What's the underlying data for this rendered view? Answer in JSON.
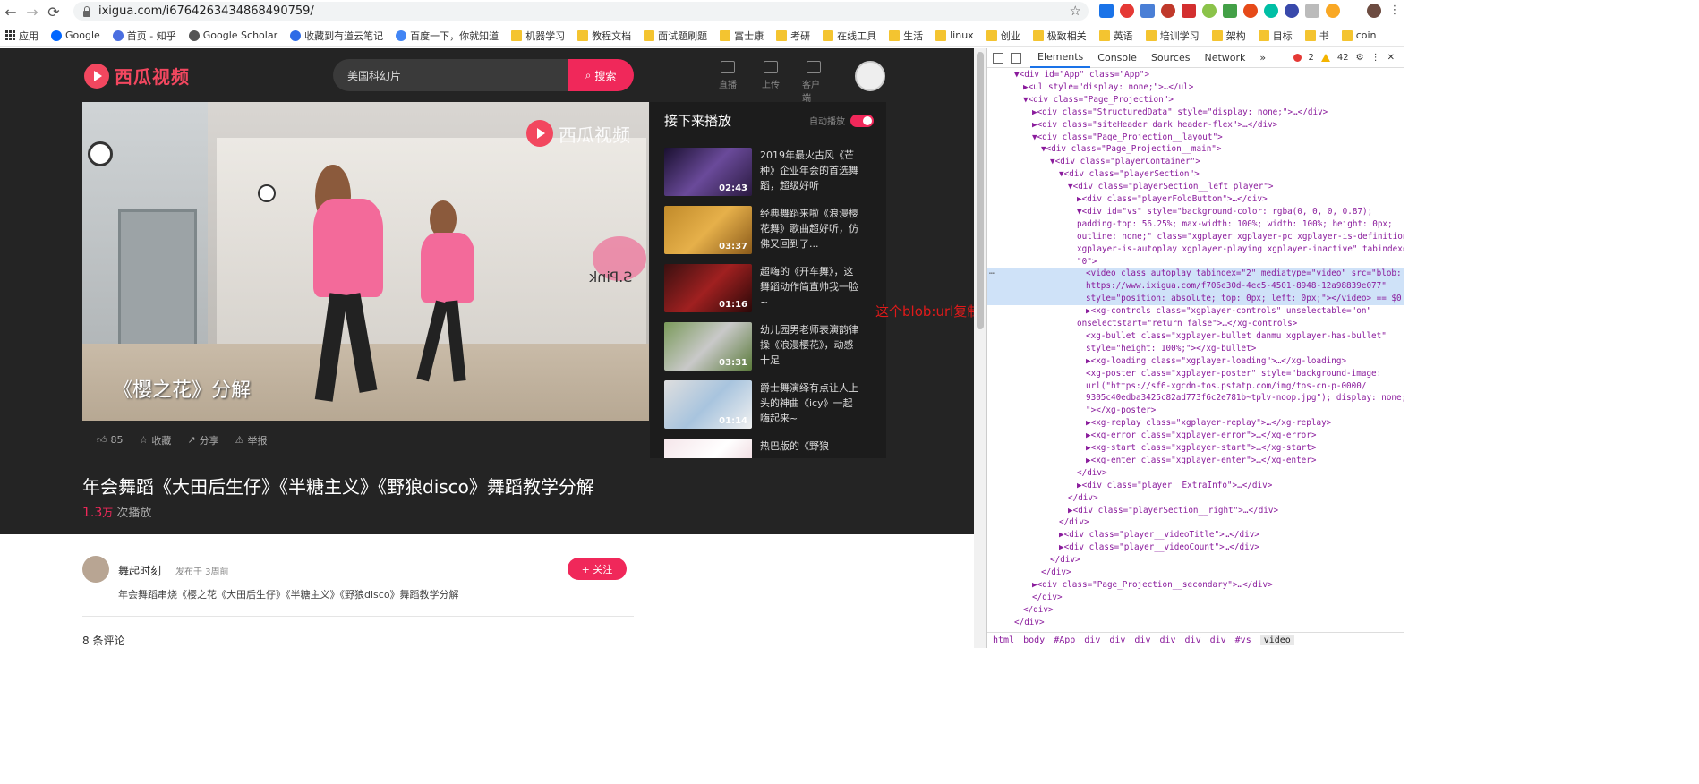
{
  "browser": {
    "url": "ixigua.com/i6764263434868490759/",
    "bookmarks": [
      {
        "label": "应用",
        "icon": "apps-grid-icon"
      },
      {
        "label": "Google",
        "icon": "google-icon"
      },
      {
        "label": "首页 - 知乎",
        "icon": "zhihu-icon"
      },
      {
        "label": "Google Scholar",
        "icon": "scholar-icon"
      },
      {
        "label": "收藏到有道云笔记",
        "icon": "youdao-icon"
      },
      {
        "label": "百度一下，你就知道",
        "icon": "baidu-icon"
      },
      {
        "label": "机器学习",
        "icon": "folder-icon"
      },
      {
        "label": "教程文档",
        "icon": "folder-icon"
      },
      {
        "label": "面试题刷题",
        "icon": "folder-icon"
      },
      {
        "label": "富士康",
        "icon": "folder-icon"
      },
      {
        "label": "考研",
        "icon": "folder-icon"
      },
      {
        "label": "在线工具",
        "icon": "folder-icon"
      },
      {
        "label": "生活",
        "icon": "folder-icon"
      },
      {
        "label": "linux",
        "icon": "folder-icon"
      },
      {
        "label": "创业",
        "icon": "folder-icon"
      },
      {
        "label": "极致相关",
        "icon": "folder-icon"
      },
      {
        "label": "英语",
        "icon": "folder-icon"
      },
      {
        "label": "培训学习",
        "icon": "folder-icon"
      },
      {
        "label": "架构",
        "icon": "folder-icon"
      },
      {
        "label": "目标",
        "icon": "folder-icon"
      },
      {
        "label": "书",
        "icon": "folder-icon"
      },
      {
        "label": "coin",
        "icon": "folder-icon"
      }
    ]
  },
  "site": {
    "logo": "西瓜视频",
    "search_value": "美国科幻片",
    "search_button": "搜索",
    "header_icons": [
      {
        "label": "直播",
        "icon": "live-icon"
      },
      {
        "label": "上传",
        "icon": "upload-icon"
      },
      {
        "label": "客户端",
        "icon": "client-icon"
      }
    ],
    "video": {
      "watermark": "西瓜视频",
      "overlay_title": "《樱之花》分解",
      "brand_text": "S.Pink",
      "likes": "85",
      "collect": "收藏",
      "share": "分享",
      "report": "举报"
    },
    "up_next": {
      "heading": "接下来播放",
      "autoplay": "自动播放",
      "items": [
        {
          "title": "2019年最火古风《芒种》企业年会的首选舞蹈，超级好听",
          "duration": "02:43"
        },
        {
          "title": "经典舞蹈来啦《浪漫樱花舞》歌曲超好听，仿佛又回到了...",
          "duration": "03:37"
        },
        {
          "title": "超嗨的《开车舞》，这舞蹈动作简直帅我一脸~",
          "duration": "01:16"
        },
        {
          "title": "幼儿园男老师表演韵律操《浪漫樱花》，动感十足",
          "duration": "03:31"
        },
        {
          "title": "爵士舞演绎有点让人上头的神曲《icy》一起嗨起来~",
          "duration": "01:14"
        },
        {
          "title": "热巴版的《野狼",
          "duration": ""
        }
      ]
    },
    "title": "年会舞蹈《大田后生仔》《半糖主义》《野狼disco》舞蹈教学分解",
    "plays_num": "1.3",
    "plays_unit": "万",
    "plays_suffix": " 次播放",
    "author": "舞起时刻",
    "published": "发布于 3周前",
    "follow": "+ 关注",
    "description": "年会舞蹈串烧《樱之花《大田后生仔》《半糖主义》《野狼disco》舞蹈教学分解",
    "comments": "8 条评论"
  },
  "annotation": "这个blob:url复制后下载不了",
  "devtools": {
    "tabs": [
      "Elements",
      "Console",
      "Sources",
      "Network",
      "»"
    ],
    "errors": "2",
    "warnings": "42",
    "breadcrumbs": [
      "html",
      "body",
      "#App",
      "div",
      "div",
      "div",
      "div",
      "div",
      "div",
      "#vs",
      "video"
    ],
    "dom_lines": [
      {
        "indent": 3,
        "text": "▼<div id=\"App\" class=\"App\">"
      },
      {
        "indent": 4,
        "text": "▶<ul style=\"display: none;\">…</ul>"
      },
      {
        "indent": 4,
        "text": "▼<div class=\"Page_Projection\">"
      },
      {
        "indent": 5,
        "text": "▶<div class=\"StructuredData\" style=\"display: none;\">…</div>"
      },
      {
        "indent": 5,
        "text": "▶<div class=\"siteHeader dark header-flex\">…</div>"
      },
      {
        "indent": 5,
        "text": "▼<div class=\"Page_Projection__layout\">"
      },
      {
        "indent": 6,
        "text": "▼<div class=\"Page_Projection__main\">"
      },
      {
        "indent": 7,
        "text": "▼<div class=\"playerContainer\">"
      },
      {
        "indent": 8,
        "text": "▼<div class=\"playerSection\">"
      },
      {
        "indent": 9,
        "text": "▼<div class=\"playerSection__left player\">"
      },
      {
        "indent": 10,
        "text": "▶<div class=\"playerFoldButton\">…</div>"
      },
      {
        "indent": 10,
        "text": "▼<div id=\"vs\" style=\"background-color: rgba(0, 0, 0, 0.87);"
      },
      {
        "indent": 10,
        "text": "padding-top: 56.25%; max-width: 100%; width: 100%; height: 0px;"
      },
      {
        "indent": 10,
        "text": "outline: none;\" class=\"xgplayer xgplayer-pc xgplayer-is-definition"
      },
      {
        "indent": 10,
        "text": "xgplayer-is-autoplay xgplayer-playing xgplayer-inactive\" tabindex="
      },
      {
        "indent": 10,
        "text": "\"0\">"
      },
      {
        "indent": 11,
        "text": "<video class autoplay tabindex=\"2\" mediatype=\"video\" src=\"blob:",
        "sel": true
      },
      {
        "indent": 11,
        "text": "https://www.ixigua.com/f706e30d-4ec5-4501-8948-12a98839e077\"",
        "sel": true
      },
      {
        "indent": 11,
        "text": "style=\"position: absolute; top: 0px; left: 0px;\"></video> == $0",
        "sel": true
      },
      {
        "indent": 11,
        "text": "▶<xg-controls class=\"xgplayer-controls\" unselectable=\"on\""
      },
      {
        "indent": 10,
        "text": "onselectstart=\"return false\">…</xg-controls>"
      },
      {
        "indent": 11,
        "text": "<xg-bullet class=\"xgplayer-bullet danmu xgplayer-has-bullet\""
      },
      {
        "indent": 11,
        "text": "style=\"height: 100%;\"></xg-bullet>"
      },
      {
        "indent": 11,
        "text": "▶<xg-loading class=\"xgplayer-loading\">…</xg-loading>"
      },
      {
        "indent": 11,
        "text": "<xg-poster class=\"xgplayer-poster\" style=\"background-image:"
      },
      {
        "indent": 11,
        "text": "url(\"https://sf6-xgcdn-tos.pstatp.com/img/tos-cn-p-0000/"
      },
      {
        "indent": 11,
        "text": "9305c40edba3425c82ad773f6c2e781b~tplv-noop.jpg\"); display: none;"
      },
      {
        "indent": 11,
        "text": "\"></xg-poster>"
      },
      {
        "indent": 11,
        "text": "▶<xg-replay class=\"xgplayer-replay\">…</xg-replay>"
      },
      {
        "indent": 11,
        "text": "▶<xg-error class=\"xgplayer-error\">…</xg-error>"
      },
      {
        "indent": 11,
        "text": "▶<xg-start class=\"xgplayer-start\">…</xg-start>"
      },
      {
        "indent": 11,
        "text": "▶<xg-enter class=\"xgplayer-enter\">…</xg-enter>"
      },
      {
        "indent": 10,
        "text": "</div>"
      },
      {
        "indent": 10,
        "text": "▶<div class=\"player__ExtraInfo\">…</div>"
      },
      {
        "indent": 9,
        "text": "</div>"
      },
      {
        "indent": 9,
        "text": "▶<div class=\"playerSection__right\">…</div>"
      },
      {
        "indent": 8,
        "text": "</div>"
      },
      {
        "indent": 8,
        "text": "▶<div class=\"player__videoTitle\">…</div>"
      },
      {
        "indent": 8,
        "text": "▶<div class=\"player__videoCount\">…</div>"
      },
      {
        "indent": 7,
        "text": "</div>"
      },
      {
        "indent": 6,
        "text": "</div>"
      },
      {
        "indent": 5,
        "text": "▶<div class=\"Page_Projection__secondary\">…</div>"
      },
      {
        "indent": 5,
        "text": "</div>"
      },
      {
        "indent": 4,
        "text": "</div>"
      },
      {
        "indent": 3,
        "text": "</div>"
      }
    ]
  }
}
